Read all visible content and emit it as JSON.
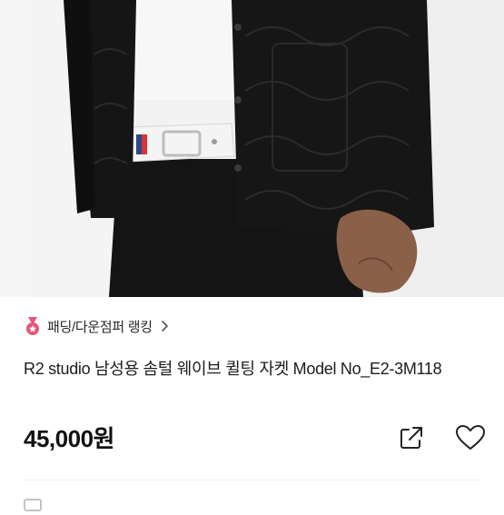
{
  "product": {
    "ranking_label": "패딩/다운점퍼 랭킹",
    "title": "R2 studio 남성용 솜털 웨이브 퀼팅 자켓 Model No_E2-3M118",
    "price": "45,000원"
  },
  "icons": {
    "ranking": "medal-icon",
    "chevron": "chevron-right-icon",
    "share": "share-icon",
    "like": "heart-icon"
  },
  "colors": {
    "medal": "#e8557a",
    "jacket": "#151515",
    "shirt": "#f7f7f7",
    "belt": "#f4f4f4"
  }
}
